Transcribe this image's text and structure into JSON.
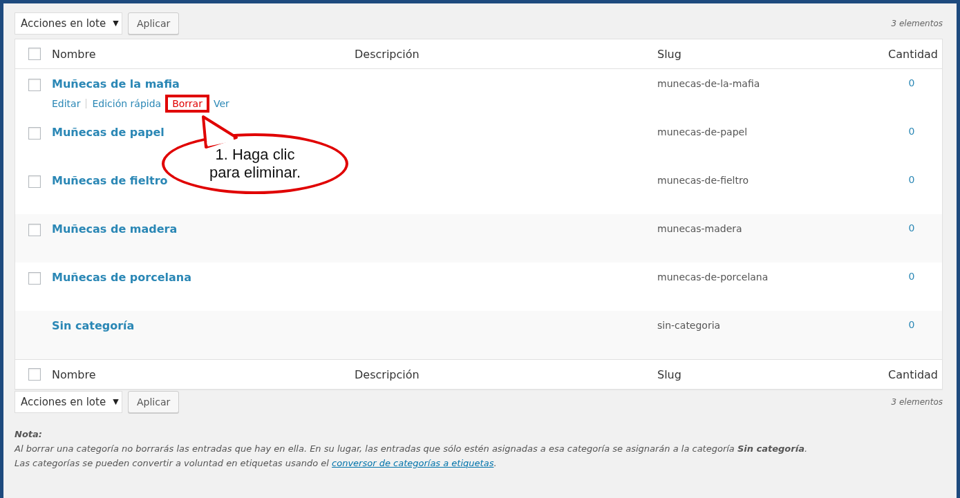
{
  "top_nav": {
    "bulk_select": "Acciones en lote",
    "dropdown_arrow": "▼",
    "apply": "Aplicar",
    "count": "3 elementos"
  },
  "table": {
    "header_checked": false,
    "footer_checked": false,
    "columns": [
      "Nombre",
      "Descripción",
      "Slug",
      "Cantidad"
    ],
    "rows": [
      {
        "name": "Muñecas de la mafia",
        "slug": "munecas-de-la-mafia",
        "count": "0",
        "checked": false,
        "actions": [
          {
            "label": "Editar",
            "kind": "normal",
            "highlighted": false
          },
          {
            "label": "Edición rápida",
            "kind": "normal",
            "highlighted": false
          },
          {
            "label": "Borrar",
            "kind": "delete",
            "highlighted": true
          },
          {
            "label": "Ver",
            "kind": "normal",
            "highlighted": false
          }
        ]
      },
      {
        "name": "Muñecas de papel",
        "slug": "munecas-de-papel",
        "count": "0",
        "checked": false
      },
      {
        "name": "Muñecas de fieltro",
        "slug": "munecas-de-fieltro",
        "count": "0",
        "checked": false
      },
      {
        "name": "Muñecas de madera",
        "slug": "munecas-madera",
        "count": "0",
        "checked": false
      },
      {
        "name": "Muñecas de porcelana",
        "slug": "munecas-de-porcelana",
        "count": "0",
        "checked": false
      },
      {
        "name": "Sin categoría",
        "slug": "sin-categoria",
        "count": "0"
      }
    ],
    "footer_columns": [
      "Nombre",
      "Descripción",
      "Slug",
      "Cantidad"
    ]
  },
  "bottom_nav": {
    "bulk_select": "Acciones en lote",
    "dropdown_arrow": "▼",
    "apply": "Aplicar",
    "count": "3 elementos"
  },
  "note": {
    "title": "Nota:",
    "text": "Al borrar una categoría no borrarás las entradas que hay en ella. En su lugar, las entradas que sólo estén asignadas a esa categoría se asignarán a la categoría **Sin categoría**.",
    "text2": "Las categorías se pueden convertir a voluntad en etiquetas usando el",
    "link": "conversor de categorías a etiquetas",
    "end": "."
  },
  "callout": {
    "lines": [
      "1. Haga clic",
      "para eliminar."
    ]
  }
}
